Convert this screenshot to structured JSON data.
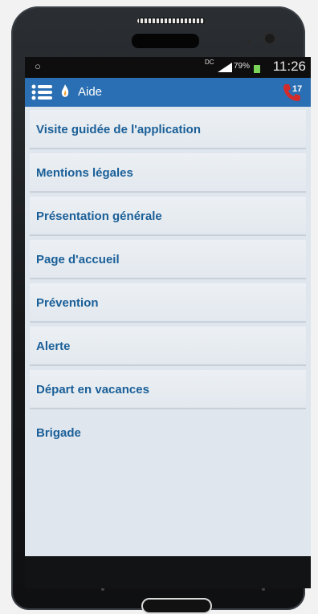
{
  "status_bar": {
    "left_icon": "circle-icon",
    "dc_label": "DC",
    "battery_percent": "79%",
    "time": "11:26",
    "colors": {
      "battery": "#7cd35a"
    }
  },
  "app_bar": {
    "title": "Aide",
    "right_icon_text": "17",
    "colors": {
      "background": "#2a6fb3",
      "accent": "#d42a2a"
    }
  },
  "menu": {
    "items": [
      {
        "label": "Visite guidée de l'application"
      },
      {
        "label": "Mentions légales"
      },
      {
        "label": "Présentation générale"
      },
      {
        "label": "Page d'accueil"
      },
      {
        "label": "Prévention"
      },
      {
        "label": "Alerte"
      },
      {
        "label": "Départ en vacances"
      },
      {
        "label": "Brigade"
      }
    ],
    "colors": {
      "text": "#1a5f98"
    }
  }
}
